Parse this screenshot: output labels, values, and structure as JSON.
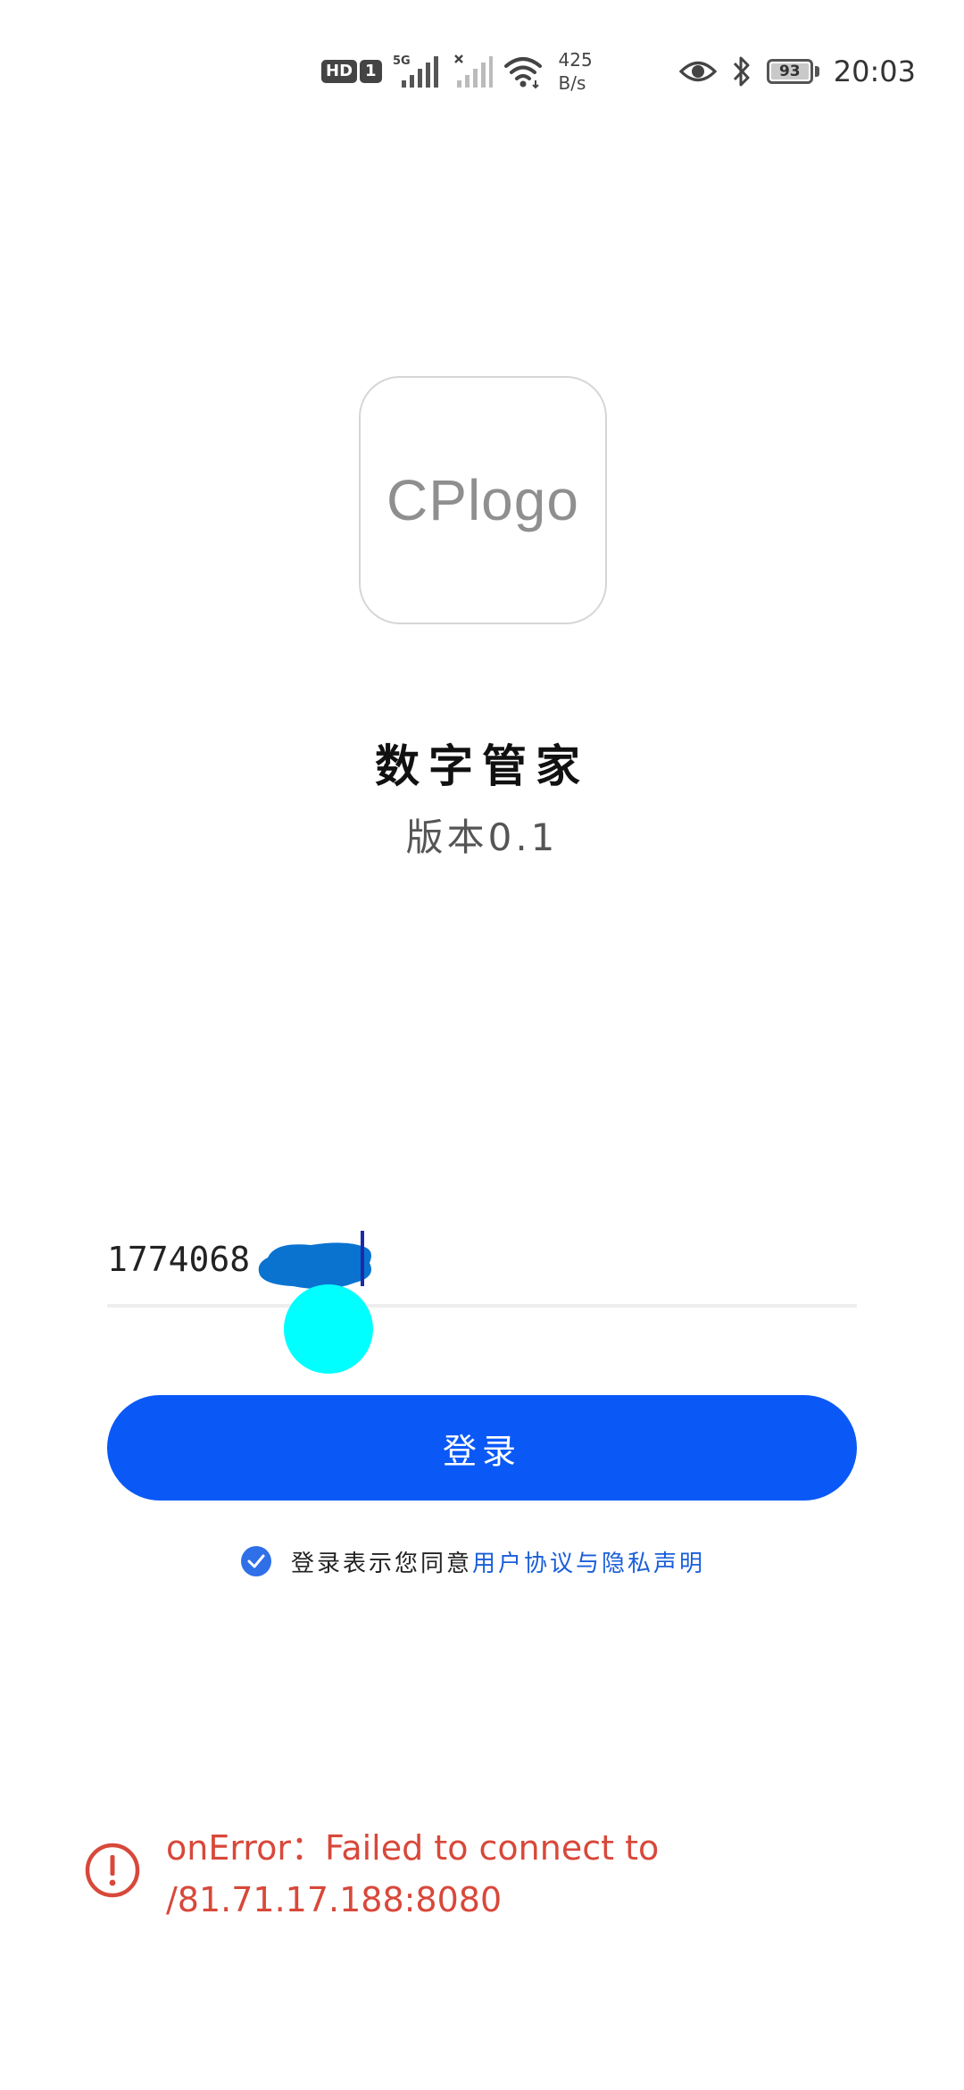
{
  "status_bar": {
    "hd": "HD",
    "sim": "1",
    "network": "5G",
    "speed_value": "425",
    "speed_unit": "B/s",
    "battery": "93",
    "time": "20:03"
  },
  "logo": {
    "text": "CPlogo"
  },
  "app": {
    "title": "数字管家",
    "version": "版本0.1"
  },
  "login_form": {
    "phone_value": "1774068",
    "login_label": "登录",
    "agreement_text": "登录表示您同意",
    "agreement_link": "用户协议与隐私声明",
    "agreement_checked": true
  },
  "error": {
    "message": "onError：Failed to connect to /81.71.17.188:8080"
  },
  "colors": {
    "primary": "#0a59f7",
    "link": "#1a5fd9",
    "error": "#d8483a",
    "touch": "#00ffff",
    "redaction": "#0a73d0"
  }
}
